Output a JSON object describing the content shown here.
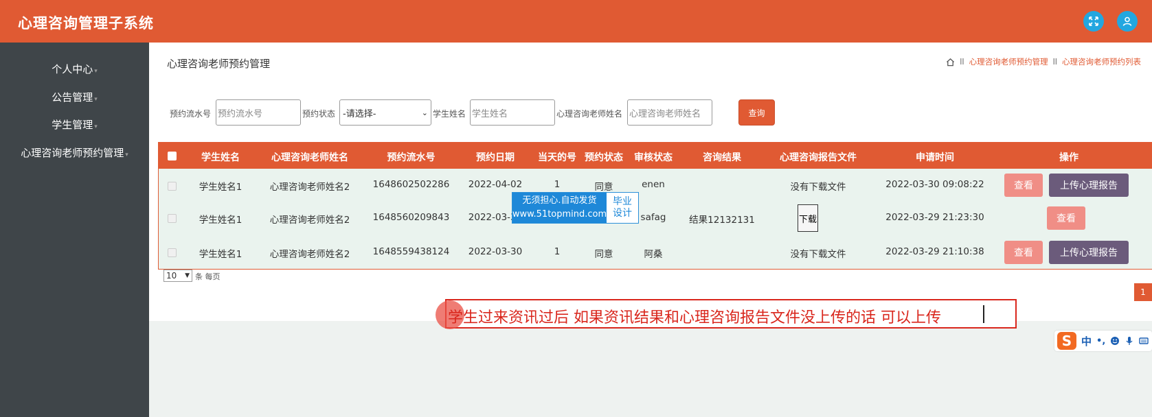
{
  "header": {
    "title": "心理咨询管理子系统"
  },
  "sidebar": {
    "items": [
      {
        "label": "个人中心"
      },
      {
        "label": "公告管理"
      },
      {
        "label": "学生管理"
      },
      {
        "label": "心理咨询老师预约管理"
      }
    ]
  },
  "page": {
    "title": "心理咨询老师预约管理",
    "breadcrumb": [
      "心理咨询老师预约管理",
      "心理咨询老师预约列表"
    ]
  },
  "filters": {
    "serial_label": "预约流水号",
    "serial_placeholder": "预约流水号",
    "status_label": "预约状态",
    "status_value": "-请选择-",
    "student_label": "学生姓名",
    "student_placeholder": "学生姓名",
    "teacher_label": "心理咨询老师姓名",
    "teacher_placeholder": "心理咨询老师姓名",
    "search_label": "查询"
  },
  "table": {
    "columns": [
      "学生姓名",
      "心理咨询老师姓名",
      "预约流水号",
      "预约日期",
      "当天的号",
      "预约状态",
      "审核状态",
      "咨询结果",
      "心理咨询报告文件",
      "申请时间",
      "操作"
    ],
    "rows": [
      {
        "student": "学生姓名1",
        "teacher": "心理咨询老师姓名2",
        "serial": "1648602502286",
        "date": "2022-04-02",
        "number": "1",
        "status": "同意",
        "review": "enen",
        "result": "",
        "file": "没有下载文件",
        "time": "2022-03-30 09:08:22",
        "view": "查看",
        "upload": "上传心理报告"
      },
      {
        "student": "学生姓名1",
        "teacher": "心理咨询老师姓名2",
        "serial": "1648560209843",
        "date": "2022-03-30",
        "number": "",
        "status": "",
        "review": "safag",
        "result": "结果12132131",
        "file": "下载",
        "time": "2022-03-29 21:23:30",
        "view": "查看",
        "upload": ""
      },
      {
        "student": "学生姓名1",
        "teacher": "心理咨询老师姓名2",
        "serial": "1648559438124",
        "date": "2022-03-30",
        "number": "1",
        "status": "同意",
        "review": "阿桑",
        "result": "",
        "file": "没有下载文件",
        "time": "2022-03-29 21:10:38",
        "view": "查看",
        "upload": "上传心理报告"
      }
    ]
  },
  "pager": {
    "page_size": "10",
    "per_page_label": "条 每页",
    "current_page": "1"
  },
  "watermark": {
    "line1": "无须担心.自动发货",
    "line2": "www.51topmind.com",
    "side1": "毕业",
    "side2": "设计"
  },
  "caption": {
    "text": "学生过来资讯过后 如果资讯结果和心理咨询报告文件没上传的话 可以上传"
  },
  "ime": {
    "mode": "中",
    "punct": "•,"
  },
  "colors": {
    "accent": "#e05a33",
    "sidebar": "#3f4549",
    "view_button": "#f08e86",
    "upload_button": "#6b5b7b",
    "header_icon": "#23a7e0"
  }
}
